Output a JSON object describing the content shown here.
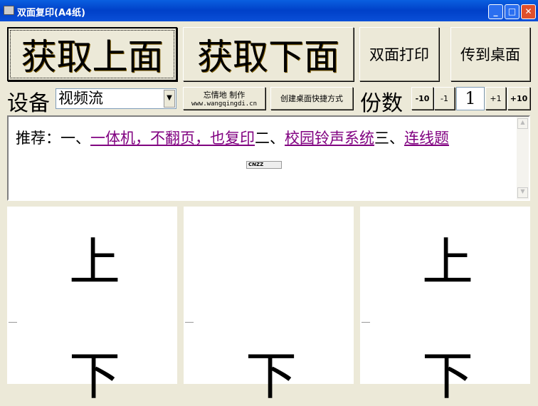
{
  "window": {
    "title": "双面复印(A4纸)",
    "min": "_",
    "max": "□",
    "close": "✕"
  },
  "buttons": {
    "get_top": "获取上面",
    "get_bottom": "获取下面",
    "duplex_print": "双面打印",
    "to_desktop": "传到桌面"
  },
  "device": {
    "label": "设备",
    "value": "视频流"
  },
  "credit": {
    "line1": "忘情地 制作",
    "line2": "www.wangqingdi.cn"
  },
  "shortcut": "创建桌面快捷方式",
  "copies": {
    "label": "份数",
    "minus10": "-10",
    "minus1": "-1",
    "value": "1",
    "plus1": "+1",
    "plus10": "+10"
  },
  "recommend": {
    "prefix": "推荐：一、",
    "link1": "一体机，不翻页，也复印",
    "sep2": "二、",
    "link2": "校园铃声系统",
    "sep3": "三、",
    "link3": "连线题",
    "badge": "CNZZ"
  },
  "panels": [
    {
      "top": "上",
      "bottom": "下"
    },
    {
      "top": "",
      "bottom": "下"
    },
    {
      "top": "上",
      "bottom": "下"
    }
  ]
}
